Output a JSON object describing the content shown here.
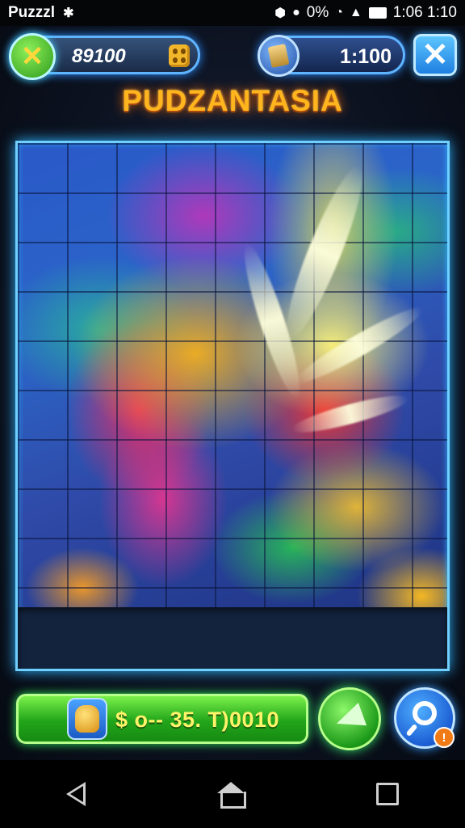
{
  "status_bar": {
    "app_name": "Puzzzl",
    "battery_percent": "0%",
    "time": "1:06 1:10"
  },
  "hud": {
    "coins": "89100",
    "timer": "1:100"
  },
  "title": "PUDZANTASIA",
  "board": {
    "columns": 9,
    "rows": 10
  },
  "bonus": {
    "value": "$ o-- 35. T)0010"
  },
  "hint": {
    "badge": "!"
  },
  "colors": {
    "board_border": "#6fd0ff",
    "title": "#ffb51e",
    "green_button": "#22a51a",
    "blue_button": "#1f7fe0"
  }
}
